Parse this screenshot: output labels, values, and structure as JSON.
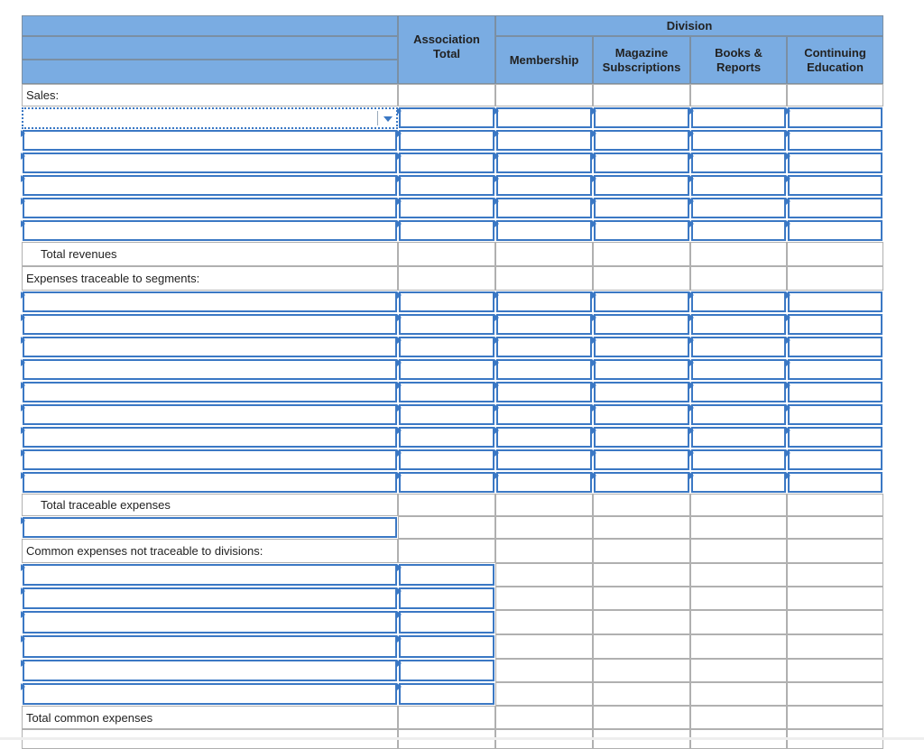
{
  "header": {
    "association_total": "Association Total",
    "division": "Division",
    "columns": [
      "Membership",
      "Magazine Subscriptions",
      "Books & Reports",
      "Continuing Education"
    ]
  },
  "sections": {
    "sales_label": "Sales:",
    "total_revenues": "Total revenues",
    "expenses_label": "Expenses traceable to segments:",
    "total_traceable": "Total traceable expenses",
    "common_label": "Common expenses not traceable to divisions:",
    "total_common": "Total common expenses"
  },
  "colors": {
    "header_bg": "#7aace2",
    "input_border": "#3b78c4"
  },
  "icons": {
    "dropdown": "chevron-down-icon",
    "input_marker": "triangle-right-icon"
  }
}
